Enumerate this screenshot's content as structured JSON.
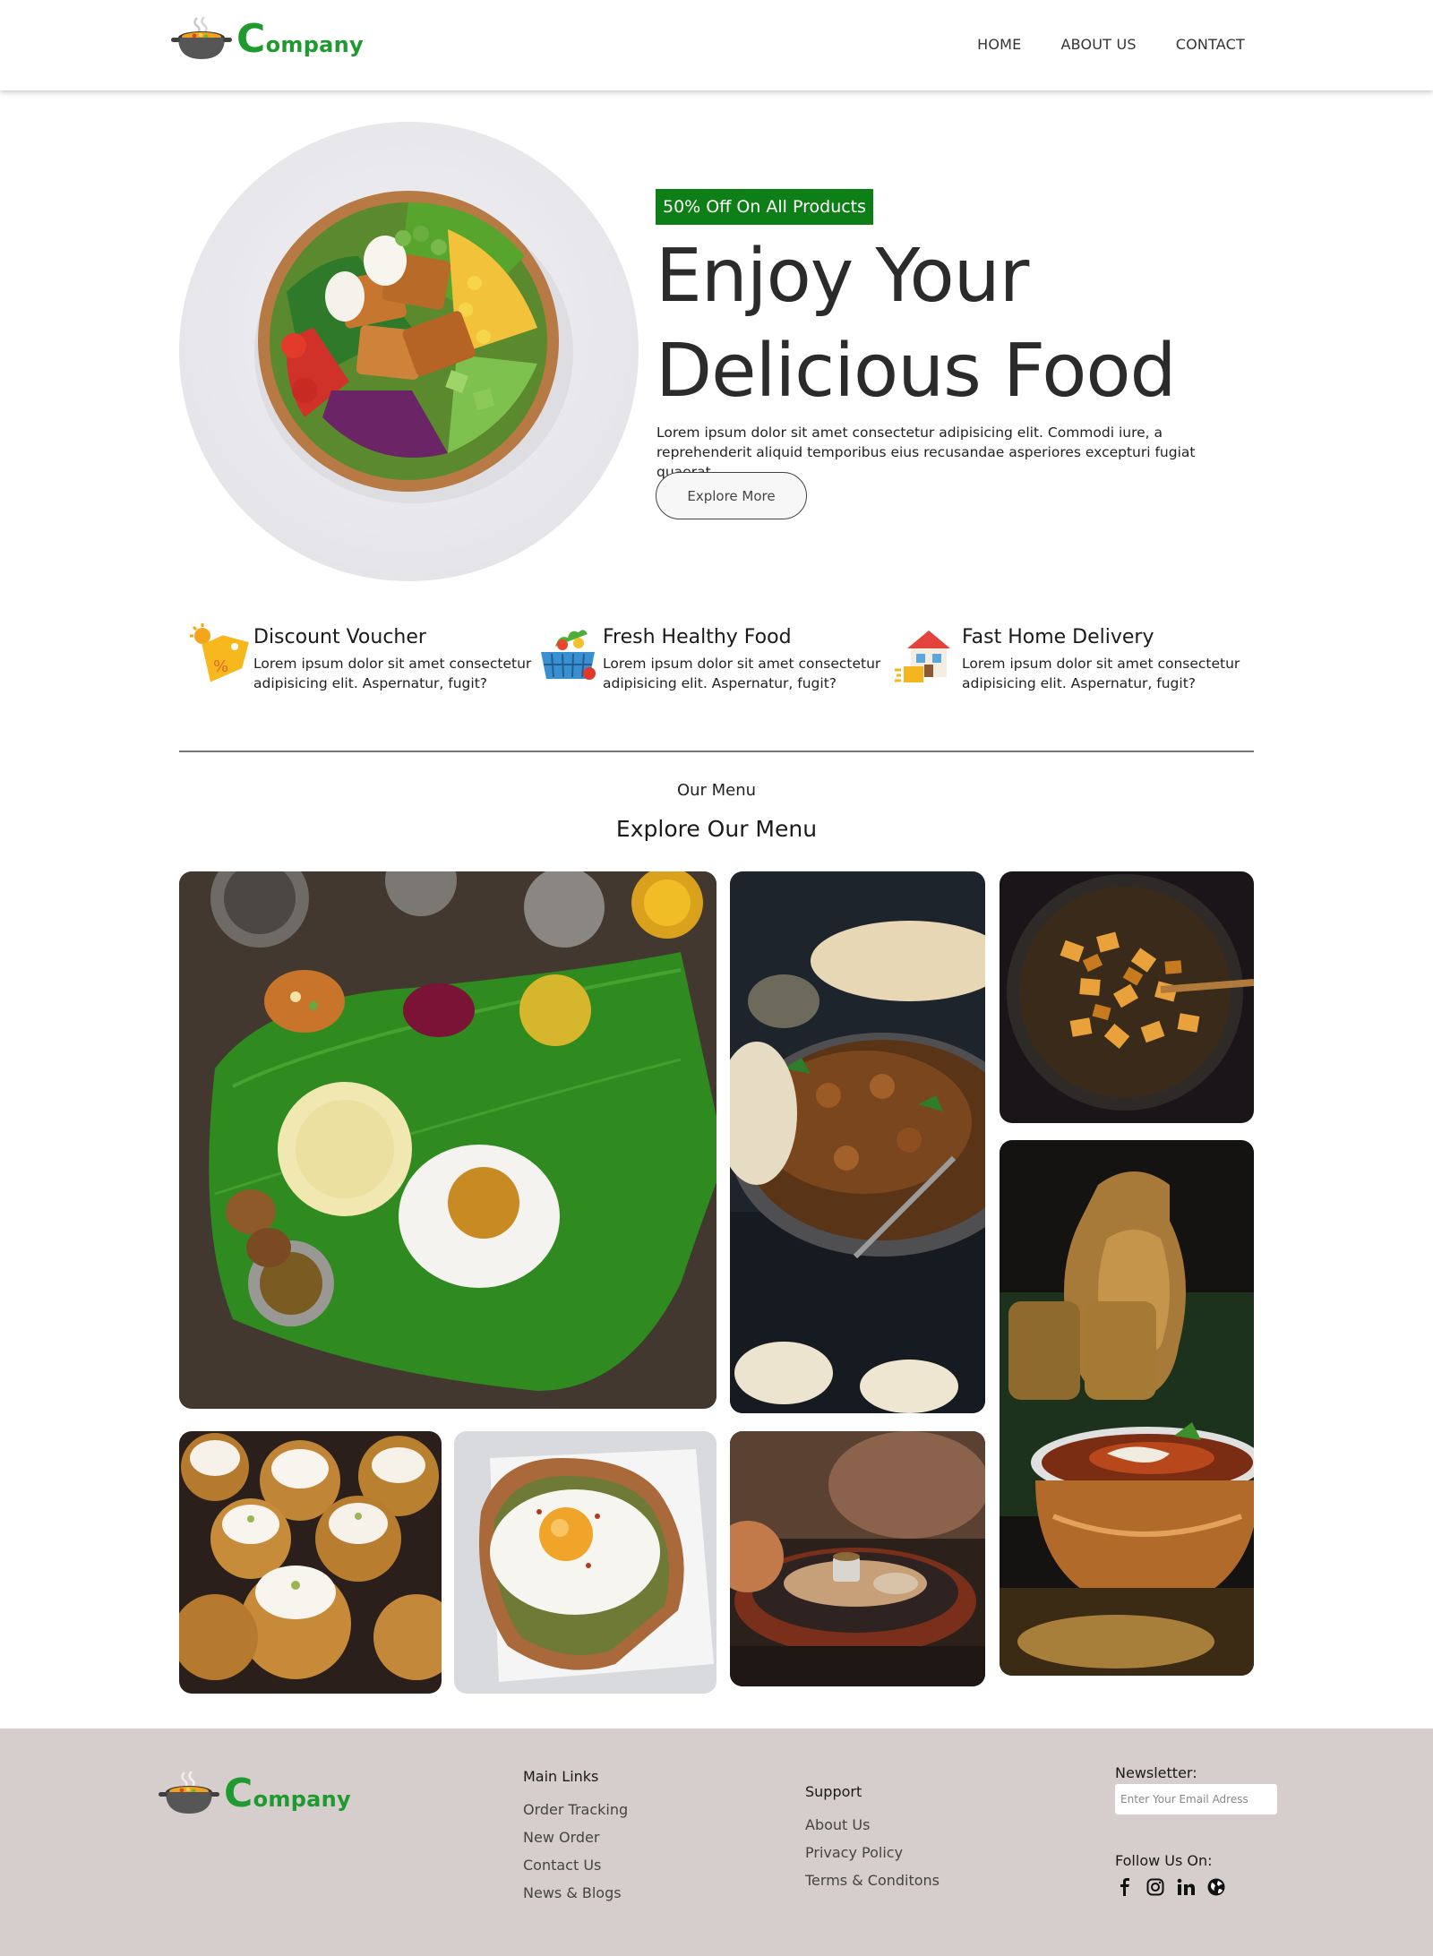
{
  "brand": {
    "logo_initial": "C",
    "logo_rest": "ompany",
    "color": "#1f9a2e"
  },
  "nav": {
    "items": [
      "HOME",
      "ABOUT US",
      "CONTACT"
    ]
  },
  "hero": {
    "badge": "50% Off On All Products",
    "title_line1": "Enjoy Your",
    "title_line2": "Delicious Food",
    "description": "Lorem ipsum dolor sit amet consectetur adipisicing elit. Commodi iure, a reprehenderit aliquid temporibus eius recusandae asperiores excepturi fugiat quaerat.",
    "button": "Explore More",
    "badge_color": "#0e7f16"
  },
  "features": [
    {
      "icon": "discount-tag-icon",
      "title": "Discount Voucher",
      "text": "Lorem ipsum dolor sit amet consectetur adipisicing elit. Aspernatur, fugit?"
    },
    {
      "icon": "grocery-basket-icon",
      "title": "Fresh Healthy Food",
      "text": "Lorem ipsum dolor sit amet consectetur adipisicing elit. Aspernatur, fugit?"
    },
    {
      "icon": "home-delivery-icon",
      "title": "Fast Home Delivery",
      "text": "Lorem ipsum dolor sit amet consectetur adipisicing elit. Aspernatur, fugit?"
    }
  ],
  "menu": {
    "kicker": "Our Menu",
    "title": "Explore Our Menu",
    "images": [
      "banana-leaf-meal",
      "chicken-curry-pan",
      "fried-potato-bowl",
      "copper-curry-pot",
      "cream-cupcakes",
      "egg-toast",
      "sizzler-plate"
    ]
  },
  "footer": {
    "main_links": {
      "title": "Main Links",
      "links": [
        "Order Tracking",
        "New Order",
        "Contact Us",
        "News & Blogs"
      ]
    },
    "support": {
      "title": "Support",
      "links": [
        "About Us",
        "Privacy Policy",
        "Terms & Conditons"
      ]
    },
    "newsletter": {
      "label": "Newsletter:",
      "placeholder": "Enter Your Email Adress"
    },
    "follow": "Follow Us On:",
    "socials": [
      "facebook-icon",
      "instagram-icon",
      "linkedin-icon",
      "globe-icon"
    ],
    "background": "#d6cdcd"
  }
}
